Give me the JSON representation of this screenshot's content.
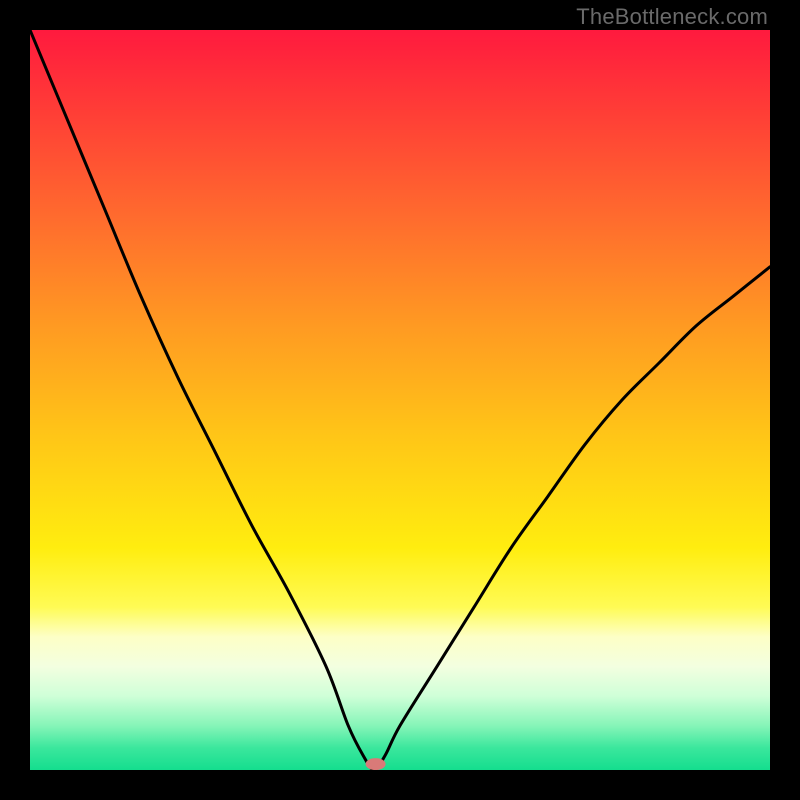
{
  "watermark": "TheBottleneck.com",
  "chart_data": {
    "type": "line",
    "title": "",
    "xlabel": "",
    "ylabel": "",
    "xlim": [
      0,
      100
    ],
    "ylim": [
      0,
      100
    ],
    "background_gradient_stops": [
      {
        "pos": 0.0,
        "color": "#ff1a3e"
      },
      {
        "pos": 0.1,
        "color": "#ff3a37"
      },
      {
        "pos": 0.25,
        "color": "#ff6a2e"
      },
      {
        "pos": 0.4,
        "color": "#ff9a22"
      },
      {
        "pos": 0.55,
        "color": "#ffc617"
      },
      {
        "pos": 0.7,
        "color": "#ffed0f"
      },
      {
        "pos": 0.78,
        "color": "#fffb55"
      },
      {
        "pos": 0.82,
        "color": "#fdffc6"
      },
      {
        "pos": 0.86,
        "color": "#f3ffe0"
      },
      {
        "pos": 0.9,
        "color": "#cfffd8"
      },
      {
        "pos": 0.94,
        "color": "#86f5b8"
      },
      {
        "pos": 0.97,
        "color": "#3be79d"
      },
      {
        "pos": 1.0,
        "color": "#14de8e"
      }
    ],
    "series": [
      {
        "name": "bottleneck-curve",
        "x": [
          0,
          5,
          10,
          15,
          20,
          25,
          30,
          35,
          40,
          43,
          45,
          46.5,
          48,
          50,
          55,
          60,
          65,
          70,
          75,
          80,
          85,
          90,
          95,
          100
        ],
        "y": [
          100,
          88,
          76,
          64,
          53,
          43,
          33,
          24,
          14,
          6,
          2,
          0,
          2,
          6,
          14,
          22,
          30,
          37,
          44,
          50,
          55,
          60,
          64,
          68
        ]
      }
    ],
    "marker": {
      "x": 46.7,
      "y": 0.8,
      "color": "#d97a78",
      "rx": 10,
      "ry": 6
    }
  }
}
